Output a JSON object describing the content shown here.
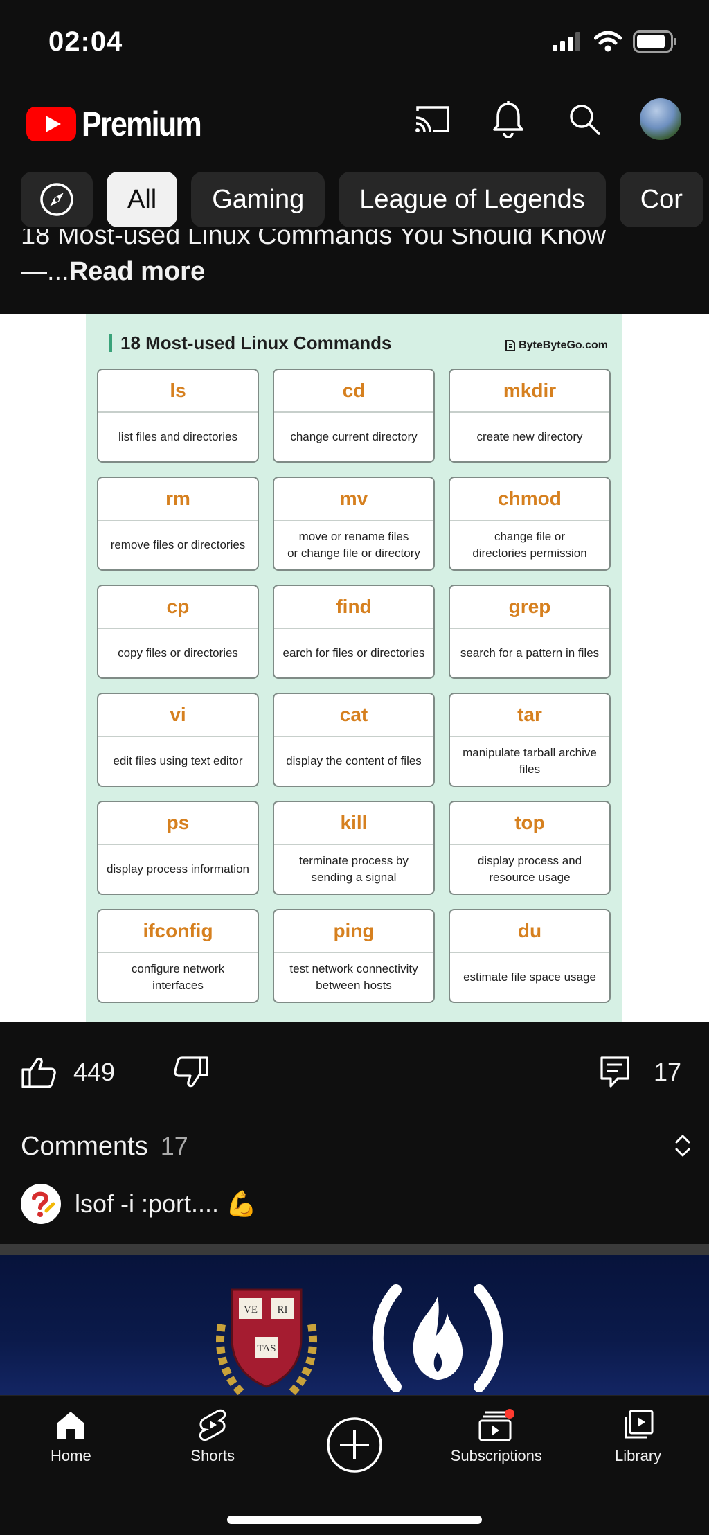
{
  "status_bar": {
    "time": "02:04"
  },
  "header": {
    "logo_text": "Premium"
  },
  "chips": [
    {
      "label": "All",
      "active": true
    },
    {
      "label": "Gaming"
    },
    {
      "label": "League of Legends"
    },
    {
      "label": "Cor"
    }
  ],
  "post": {
    "text_line": "18 Most-used Linux Commands You Should Know",
    "text_prefix": "—...",
    "read_more": "Read more"
  },
  "infographic": {
    "title": "18 Most-used Linux Commands",
    "brand": "ByteByteGo.com",
    "commands": [
      {
        "name": "ls",
        "desc": "list files and directories"
      },
      {
        "name": "cd",
        "desc": "change current directory"
      },
      {
        "name": "mkdir",
        "desc": "create new directory"
      },
      {
        "name": "rm",
        "desc": "remove files or directories"
      },
      {
        "name": "mv",
        "desc": "move or rename files\nor change file or directory"
      },
      {
        "name": "chmod",
        "desc": "change file or\ndirectories permission"
      },
      {
        "name": "cp",
        "desc": "copy files or directories"
      },
      {
        "name": "find",
        "desc": "earch for files or directories"
      },
      {
        "name": "grep",
        "desc": "search for a pattern in files"
      },
      {
        "name": "vi",
        "desc": "edit files using text editor"
      },
      {
        "name": "cat",
        "desc": "display the content of files"
      },
      {
        "name": "tar",
        "desc": "manipulate tarball archive\nfiles"
      },
      {
        "name": "ps",
        "desc": "display process information"
      },
      {
        "name": "kill",
        "desc": "terminate process by\nsending a signal"
      },
      {
        "name": "top",
        "desc": "display process and\nresource usage"
      },
      {
        "name": "ifconfig",
        "desc": "configure network\ninterfaces"
      },
      {
        "name": "ping",
        "desc": "test network connectivity\nbetween hosts"
      },
      {
        "name": "du",
        "desc": "estimate file space usage"
      }
    ]
  },
  "actions": {
    "likes": "449",
    "comments_count": "17"
  },
  "comments": {
    "title": "Comments",
    "count": "17",
    "preview_text": "lsof -i :port.... 💪"
  },
  "next_video": {
    "shield_labels": [
      "VE",
      "RI",
      "TAS"
    ]
  },
  "bottom_nav": [
    {
      "label": "Home",
      "icon": "home-icon"
    },
    {
      "label": "Shorts",
      "icon": "shorts-icon"
    },
    {
      "label": "",
      "icon": "create-icon"
    },
    {
      "label": "Subscriptions",
      "icon": "subscriptions-icon"
    },
    {
      "label": "Library",
      "icon": "library-icon"
    }
  ],
  "colors": {
    "background": "#0f0f0f",
    "chip": "#272727",
    "brand_red": "#ff0000",
    "command_orange": "#d6801f",
    "infographic_bg": "#d6f0e4"
  }
}
